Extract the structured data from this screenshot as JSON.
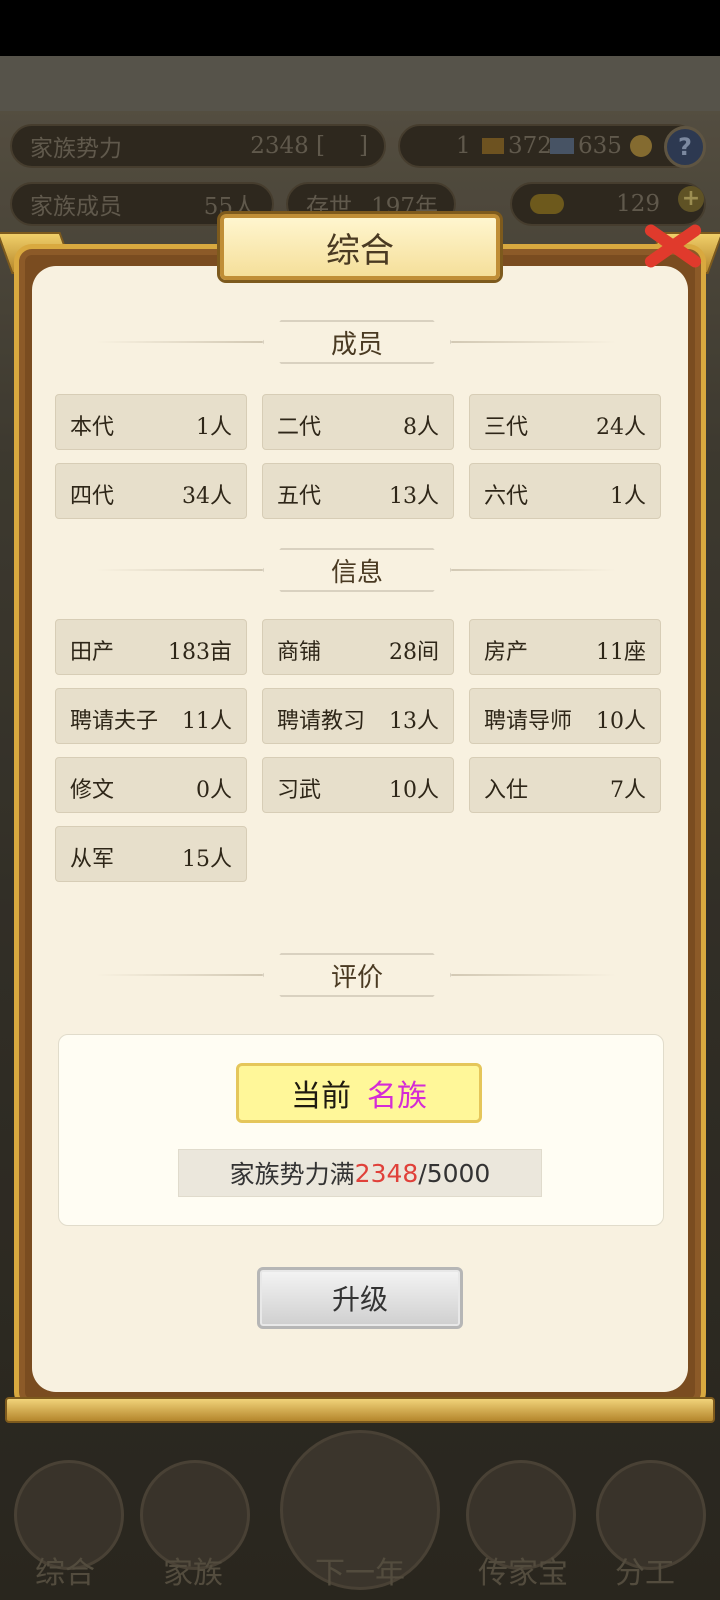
{
  "hud": {
    "power_label": "家族势力",
    "power_value": "2348 [",
    "power_value_end": "]",
    "resources": "1",
    "gold_bars": "372",
    "silver": "635",
    "members_label": "家族成员",
    "members_value": "55人",
    "era_label": "存世",
    "era_value": "197年",
    "ingots": "129"
  },
  "modal": {
    "title": "综合",
    "section_members": "成员",
    "members": [
      {
        "k": "本代",
        "v": "1人"
      },
      {
        "k": "二代",
        "v": "8人"
      },
      {
        "k": "三代",
        "v": "24人"
      },
      {
        "k": "四代",
        "v": "34人"
      },
      {
        "k": "五代",
        "v": "13人"
      },
      {
        "k": "六代",
        "v": "1人"
      }
    ],
    "section_info": "信息",
    "info": [
      {
        "k": "田产",
        "v": "183亩"
      },
      {
        "k": "商铺",
        "v": "28间"
      },
      {
        "k": "房产",
        "v": "11座"
      },
      {
        "k": "聘请夫子",
        "v": "11人"
      },
      {
        "k": "聘请教习",
        "v": "13人"
      },
      {
        "k": "聘请导师",
        "v": "10人"
      },
      {
        "k": "修文",
        "v": "0人"
      },
      {
        "k": "习武",
        "v": "10人"
      },
      {
        "k": "入仕",
        "v": "7人"
      },
      {
        "k": "从军",
        "v": "15人"
      }
    ],
    "section_eval": "评价",
    "current_label": "当前",
    "current_rank": "名族",
    "power_label": "家族势力满",
    "power_current": "2348",
    "power_max": "/5000",
    "upgrade_label": "升级"
  },
  "nav": {
    "items": [
      "综合",
      "家族",
      "下一年",
      "传家宝",
      "分工"
    ]
  },
  "colors": {
    "accent_gold": "#d9a93f",
    "rank_magenta": "#d52bd6",
    "power_red": "#e0413a",
    "close_red": "#e03a2c"
  }
}
